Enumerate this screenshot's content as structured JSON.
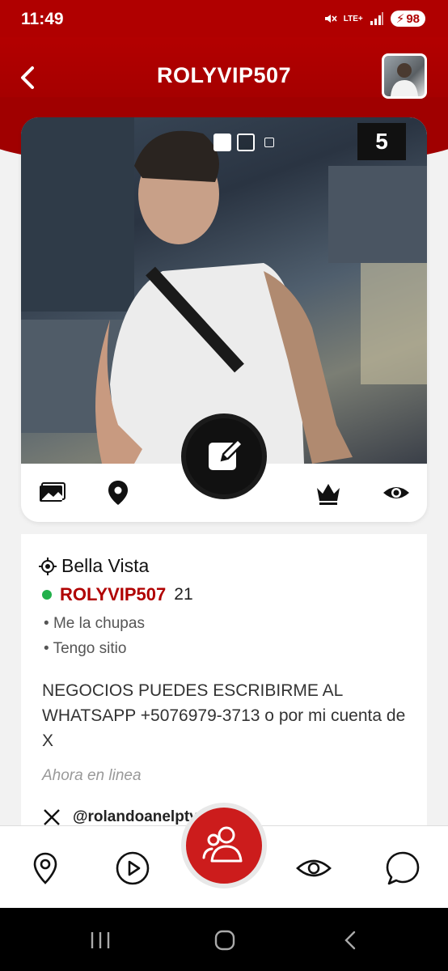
{
  "status_bar": {
    "time": "11:49",
    "battery": "98",
    "network": "LTE+"
  },
  "header": {
    "title": "ROLYVIP507"
  },
  "photo": {
    "count": "5"
  },
  "profile": {
    "location": "Bella Vista",
    "username": "ROLYVIP507",
    "age": "21",
    "tags": [
      "Me la chupas",
      "Tengo sitio"
    ],
    "description": "NEGOCIOS PUEDES ESCRIBIRME AL WHATSAPP +5076979-3713 o por mi cuenta de X",
    "online_status": "Ahora en linea",
    "social_handle": "@rolandoanelpty"
  },
  "colors": {
    "brand_red": "#b00000",
    "online_green": "#22b04b"
  },
  "icons": [
    "back-icon",
    "avatar",
    "gallery-icon",
    "location-pin-icon",
    "edit-icon",
    "crown-icon",
    "eye-icon",
    "target-icon",
    "x-logo-icon",
    "map-pin-icon",
    "play-icon",
    "group-icon",
    "chat-icon"
  ]
}
